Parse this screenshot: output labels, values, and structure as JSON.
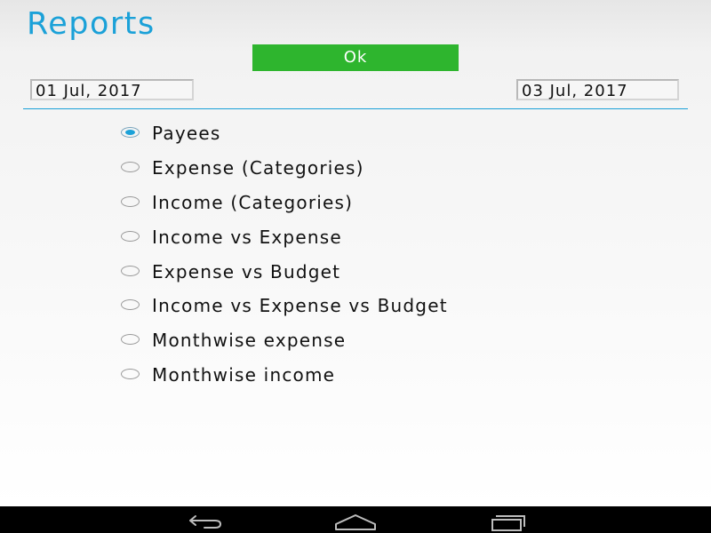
{
  "header": {
    "title": "Reports"
  },
  "actions": {
    "ok_label": "Ok"
  },
  "date_range": {
    "from": "01 Jul, 2017",
    "to": "03 Jul, 2017"
  },
  "report_options": [
    {
      "label": "Payees",
      "selected": true
    },
    {
      "label": "Expense (Categories)",
      "selected": false
    },
    {
      "label": "Income (Categories)",
      "selected": false
    },
    {
      "label": "Income vs Expense",
      "selected": false
    },
    {
      "label": "Expense vs Budget",
      "selected": false
    },
    {
      "label": "Income vs Expense vs Budget",
      "selected": false
    },
    {
      "label": "Monthwise expense",
      "selected": false
    },
    {
      "label": "Monthwise income",
      "selected": false
    }
  ],
  "navbar": {
    "icons": [
      "back-icon",
      "home-icon",
      "recent-apps-icon"
    ]
  },
  "colors": {
    "accent": "#1ba1d8",
    "ok_button": "#2eb52e",
    "navbar": "#000000"
  }
}
